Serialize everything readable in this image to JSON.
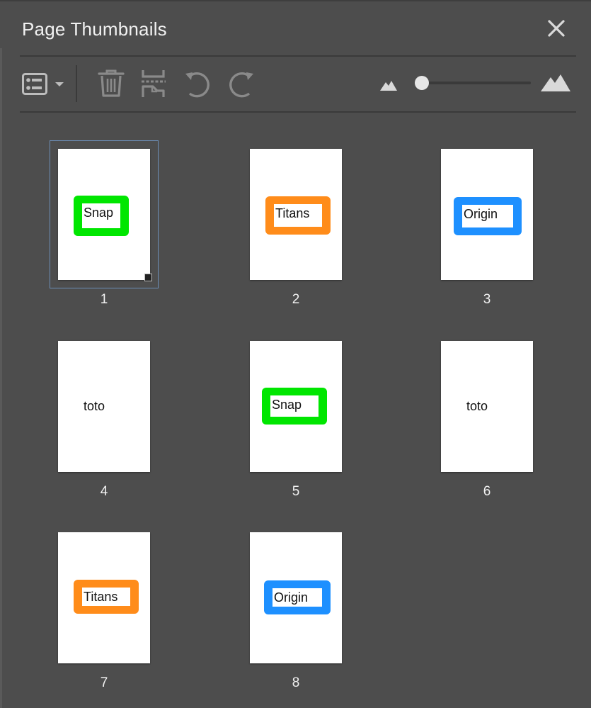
{
  "panel": {
    "title": "Page Thumbnails",
    "close_icon": "close-icon"
  },
  "toolbar": {
    "options_icon": "list-options-icon",
    "dropdown_icon": "chevron-down-icon",
    "delete_icon": "trash-icon",
    "extract_icon": "extract-pages-icon",
    "rotate_ccw_icon": "rotate-counterclockwise-icon",
    "rotate_cw_icon": "rotate-clockwise-icon",
    "zoom_out_icon": "small-mountain-icon",
    "zoom_in_icon": "large-mountain-icon",
    "zoom_level": 0.0
  },
  "colors": {
    "panel_bg": "#4d4d4d",
    "snap": "#00e600",
    "titans": "#ff8c1a",
    "origin": "#1e90ff",
    "selection_border": "#6d8fb8"
  },
  "pages": [
    {
      "number": "1",
      "label": "Snap",
      "style": "badge",
      "color": "#00e600",
      "selected": true
    },
    {
      "number": "2",
      "label": "Titans",
      "style": "badge",
      "color": "#ff8c1a",
      "selected": false
    },
    {
      "number": "3",
      "label": "Origin",
      "style": "badge",
      "color": "#1e90ff",
      "selected": false
    },
    {
      "number": "4",
      "label": "toto",
      "style": "plain",
      "color": "",
      "selected": false
    },
    {
      "number": "5",
      "label": "Snap",
      "style": "badge",
      "color": "#00e600",
      "selected": false
    },
    {
      "number": "6",
      "label": "toto",
      "style": "plain",
      "color": "",
      "selected": false
    },
    {
      "number": "7",
      "label": "Titans",
      "style": "badge",
      "color": "#ff8c1a",
      "selected": false
    },
    {
      "number": "8",
      "label": "Origin",
      "style": "badge",
      "color": "#1e90ff",
      "selected": false
    }
  ]
}
